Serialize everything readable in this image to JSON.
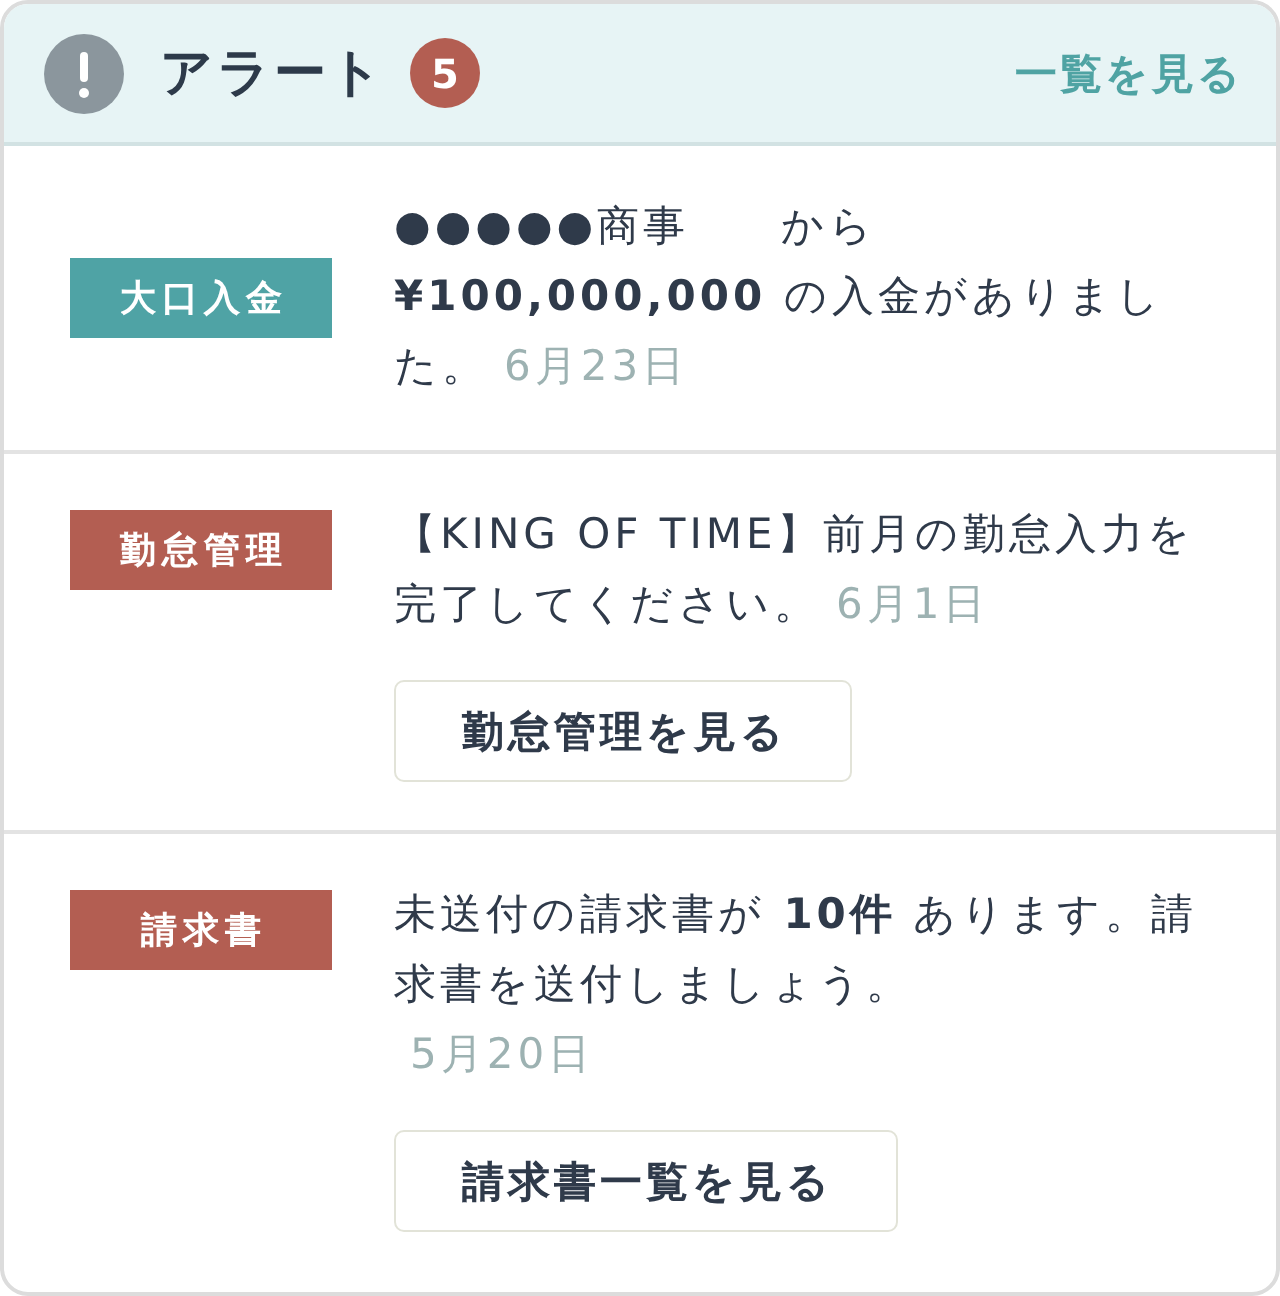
{
  "header": {
    "title": "アラート",
    "count": "5",
    "link": "一覧を見る"
  },
  "alerts": [
    {
      "tag": "大口入金",
      "color": "#4fa3a5",
      "message": "●●●●●商事　　から **¥100,000,000** の入金がありました。",
      "date": "6月23日",
      "date_own_line": false
    },
    {
      "tag": "勤怠管理",
      "color": "#b35e52",
      "message": "【KING OF TIME】前月の勤怠入力を完了してください。",
      "date": "6月1日",
      "date_own_line": false,
      "button": "勤怠管理を見る"
    },
    {
      "tag": "請求書",
      "color": "#b35e52",
      "message": "未送付の請求書が **10件** あります。請求書を送付しましょう。",
      "date": "5月20日",
      "date_own_line": true,
      "button": "請求書一覧を見る"
    }
  ]
}
